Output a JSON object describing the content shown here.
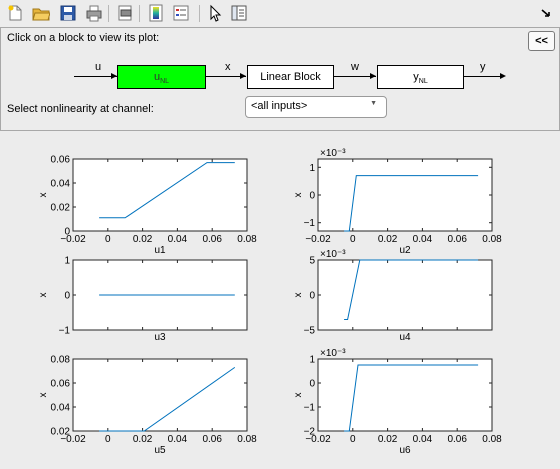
{
  "toolbar": {
    "buttons": [
      {
        "icon": "new-document-icon"
      },
      {
        "icon": "open-folder-icon"
      },
      {
        "icon": "save-icon"
      },
      {
        "icon": "print-icon"
      },
      {
        "icon": "print-preview-icon"
      },
      {
        "icon": "colorbar-icon"
      },
      {
        "icon": "legend-icon"
      },
      {
        "icon": "pointer-icon"
      },
      {
        "icon": "plot-browser-icon"
      },
      {
        "icon": "dock-arrow-icon"
      }
    ]
  },
  "panel": {
    "prompt": "Click on a block to view its plot:",
    "collapse_label": "<<",
    "blocks": {
      "input_nl": "u",
      "input_nl_sub": "NL",
      "linear": "Linear Block",
      "output_nl": "y",
      "output_nl_sub": "NL"
    },
    "signals": {
      "u": "u",
      "x": "x",
      "w": "w",
      "y": "y"
    },
    "select_label": "Select nonlinearity at channel:",
    "select_value": "<all inputs>",
    "colors": {
      "selected_block": "#00ff00",
      "line": "#0072bd"
    }
  },
  "chart_data": [
    {
      "type": "line",
      "xlabel": "u1",
      "ylabel": "x",
      "xlim": [
        -0.02,
        0.08
      ],
      "ylim": [
        0,
        0.06
      ],
      "xticks": [
        "−0.02",
        "0",
        "0.02",
        "0.04",
        "0.06",
        "0.08"
      ],
      "yticks": [
        "0",
        "0.02",
        "0.04",
        "0.06"
      ],
      "exponent": "",
      "x": [
        -0.005,
        0.01,
        0.057,
        0.073
      ],
      "y": [
        0.011,
        0.011,
        0.057,
        0.057
      ]
    },
    {
      "type": "line",
      "xlabel": "u2",
      "ylabel": "x",
      "xlim": [
        -0.02,
        0.08
      ],
      "ylim": [
        -1.3,
        1.3
      ],
      "xticks": [
        "−0.02",
        "0",
        "0.02",
        "0.04",
        "0.06",
        "0.08"
      ],
      "yticks": [
        "−1",
        "0",
        "1"
      ],
      "exponent": "×10⁻³",
      "x": [
        -0.005,
        -0.002,
        0.002,
        0.072
      ],
      "y": [
        -1.3,
        -1.3,
        0.7,
        0.7
      ]
    },
    {
      "type": "line",
      "xlabel": "u3",
      "ylabel": "x",
      "xlim": [
        -0.02,
        0.08
      ],
      "ylim": [
        -1,
        1
      ],
      "xticks": [],
      "yticks": [
        "−1",
        "0",
        "1"
      ],
      "exponent": "",
      "x": [
        -0.005,
        0.073
      ],
      "y": [
        0,
        0
      ]
    },
    {
      "type": "line",
      "xlabel": "u4",
      "ylabel": "x",
      "xlim": [
        -0.02,
        0.08
      ],
      "ylim": [
        -5,
        5
      ],
      "xticks": [],
      "yticks": [
        "−5",
        "0",
        "5"
      ],
      "exponent": "×10⁻³",
      "x": [
        -0.005,
        -0.003,
        0.004,
        0.072
      ],
      "y": [
        -3.5,
        -3.5,
        5,
        5
      ]
    },
    {
      "type": "line",
      "xlabel": "u5",
      "ylabel": "x",
      "xlim": [
        -0.02,
        0.08
      ],
      "ylim": [
        0.02,
        0.08
      ],
      "xticks": [
        "−0.02",
        "0",
        "0.02",
        "0.04",
        "0.06",
        "0.08"
      ],
      "yticks": [
        "0.02",
        "0.04",
        "0.06",
        "0.08"
      ],
      "exponent": "",
      "x": [
        -0.005,
        0.021,
        0.073
      ],
      "y": [
        0.02,
        0.02,
        0.073
      ]
    },
    {
      "type": "line",
      "xlabel": "u6",
      "ylabel": "x",
      "xlim": [
        -0.02,
        0.08
      ],
      "ylim": [
        -2,
        1
      ],
      "xticks": [
        "−0.02",
        "0",
        "0.02",
        "0.04",
        "0.06",
        "0.08"
      ],
      "yticks": [
        "−2",
        "−1",
        "0",
        "1"
      ],
      "exponent": "×10⁻³",
      "x": [
        -0.005,
        -0.002,
        0.003,
        0.072
      ],
      "y": [
        -2,
        -2,
        0.75,
        0.75
      ]
    }
  ]
}
